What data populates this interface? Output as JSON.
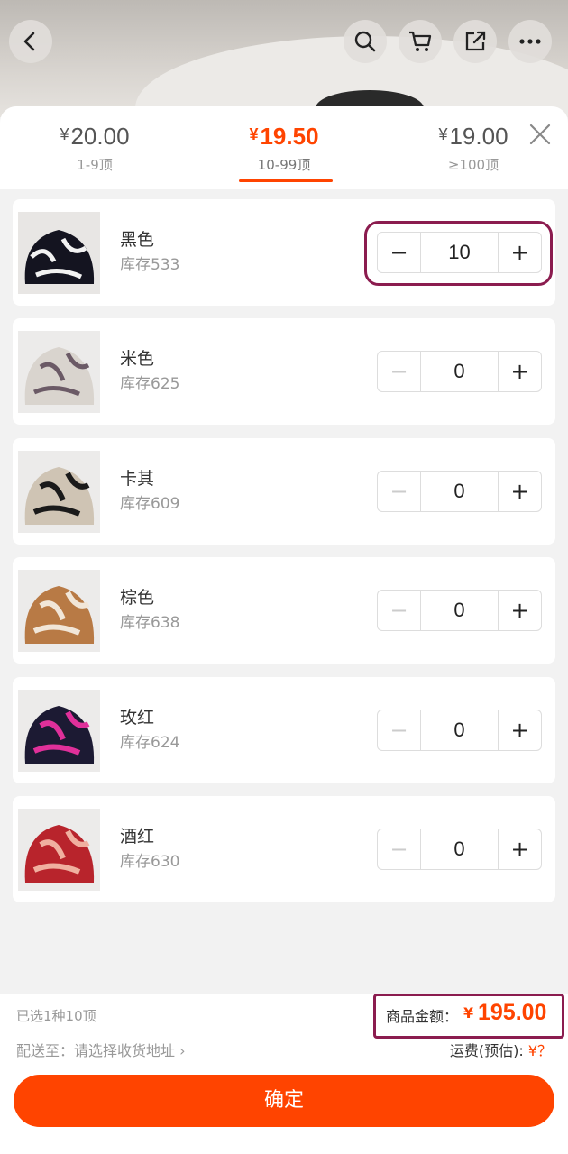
{
  "header": {
    "icons": [
      "back-icon",
      "search-icon",
      "cart-icon",
      "share-icon",
      "more-icon"
    ]
  },
  "tiers": [
    {
      "currency": "¥",
      "price": "20.00",
      "range": "1-9顶"
    },
    {
      "currency": "¥",
      "price": "19.50",
      "range": "10-99顶"
    },
    {
      "currency": "¥",
      "price": "19.00",
      "range": "≥100顶"
    }
  ],
  "active_tier": 1,
  "items": [
    {
      "name": "黑色",
      "stock": "库存533",
      "qty": "10",
      "minus": "−",
      "plus": "+"
    },
    {
      "name": "米色",
      "stock": "库存625",
      "qty": "0",
      "minus": "−",
      "plus": "+"
    },
    {
      "name": "卡其",
      "stock": "库存609",
      "qty": "0",
      "minus": "−",
      "plus": "+"
    },
    {
      "name": "棕色",
      "stock": "库存638",
      "qty": "0",
      "minus": "−",
      "plus": "+"
    },
    {
      "name": "玫红",
      "stock": "库存624",
      "qty": "0",
      "minus": "−",
      "plus": "+"
    },
    {
      "name": "酒红",
      "stock": "库存630",
      "qty": "0",
      "minus": "−",
      "plus": "+"
    }
  ],
  "footer": {
    "selected": "已选1种10顶",
    "ship_to": "配送至：请选择收货地址 ›",
    "amount_label": "商品金额：",
    "amount_currency": "¥",
    "amount_value": "195.00",
    "freight_label": "运费(预估): ",
    "freight_value": "¥？",
    "confirm": "确定"
  },
  "colors": {
    "accent": "#ff4400",
    "highlight": "#8b1c4f"
  }
}
